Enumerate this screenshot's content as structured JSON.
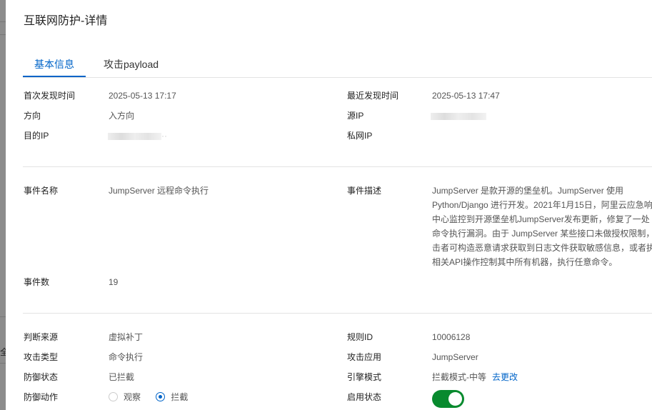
{
  "title": "互联网防护-详情",
  "backdrop_char": "全",
  "tabs": [
    {
      "label": "基本信息",
      "active": true
    },
    {
      "label": "攻击payload",
      "active": false
    }
  ],
  "basic": {
    "first_seen_label": "首次发现时间",
    "first_seen": "2025-05-13 17:17",
    "last_seen_label": "最近发现时间",
    "last_seen": "2025-05-13 17:47",
    "direction_label": "方向",
    "direction": "入方向",
    "src_ip_label": "源IP",
    "dst_ip_label": "目的IP",
    "dst_ip_suffix": "··",
    "private_ip_label": "私网IP"
  },
  "event": {
    "name_label": "事件名称",
    "name": "JumpServer 远程命令执行",
    "desc_label": "事件描述",
    "desc_lines": [
      "JumpServer 是款开源的堡垒机。JumpServer 使用",
      "Python/Django 进行开发。2021年1月15日，阿里云应急响",
      "中心监控到开源堡垒机JumpServer发布更新，修复了一处",
      "命令执行漏洞。由于 JumpServer 某些接口未做授权限制，攻",
      "击者可构造恶意请求获取到日志文件获取敏感信息，或者执",
      "相关API操作控制其中所有机器，执行任意命令。"
    ],
    "count_label": "事件数",
    "count": "19"
  },
  "rule": {
    "source_label": "判断来源",
    "source": "虚拟补丁",
    "rule_id_label": "规则ID",
    "rule_id": "10006128",
    "attack_type_label": "攻击类型",
    "attack_type": "命令执行",
    "attack_app_label": "攻击应用",
    "attack_app": "JumpServer",
    "defense_status_label": "防御状态",
    "defense_status": "已拦截",
    "engine_mode_label": "引擎模式",
    "engine_mode": "拦截模式-中等",
    "engine_mode_link": "去更改",
    "defense_action_label": "防御动作",
    "defense_action_options": [
      "观察",
      "拦截"
    ],
    "defense_action_selected": "拦截",
    "enabled_label": "启用状态",
    "enabled": true
  },
  "colors": {
    "accent": "#0064c8",
    "toggle_on": "#088a2e"
  }
}
